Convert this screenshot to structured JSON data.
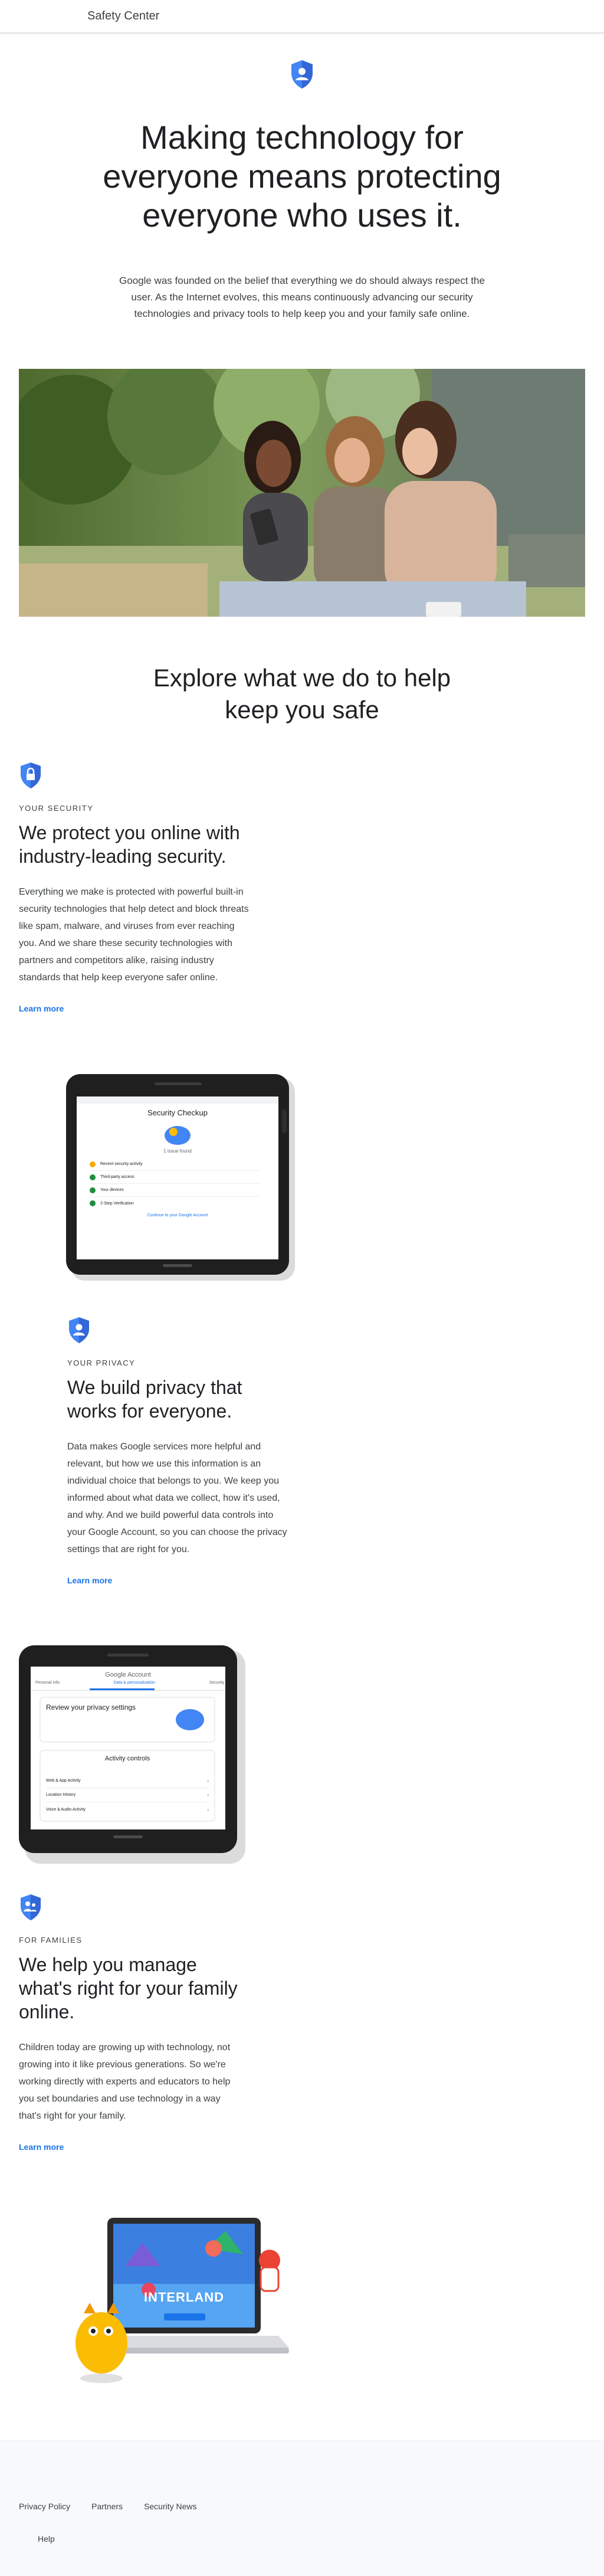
{
  "header": {
    "title": "Safety Center"
  },
  "hero": {
    "headline": "Making technology for everyone means protecting everyone who uses it.",
    "intro": "Google was founded on the belief that everything we do should always respect the user. As the Internet evolves, this means continuously advancing our security technologies and privacy tools to help keep you and your family safe online."
  },
  "explore": {
    "title": "Explore what we do to help keep you safe"
  },
  "sections": [
    {
      "eyebrow": "YOUR SECURITY",
      "title": "We protect you online with industry-leading security.",
      "body": "Everything we make is protected with powerful built-in security technologies that help detect and block threats like spam, malware, and viruses from ever reaching you. And we share these security technologies with partners and competitors alike, raising industry standards that help keep everyone safer online.",
      "link": "Learn more",
      "icon": "lock-shield-icon"
    },
    {
      "eyebrow": "YOUR PRIVACY",
      "title": "We build privacy that works for everyone.",
      "body": "Data makes Google services more helpful and relevant, but how we use this information is an individual choice that belongs to you. We keep you informed about what data we collect, how it's used, and why. And we build powerful data controls into your Google Account, so you can choose the privacy settings that are right for you.",
      "link": "Learn more",
      "icon": "person-shield-icon"
    },
    {
      "eyebrow": "FOR FAMILIES",
      "title": "We help you manage what's right for your family online.",
      "body": "Children today are growing up with technology, not growing into it like previous generations. So we're working directly with experts and educators to help you set boundaries and use technology in a way that's right for your family.",
      "link": "Learn more",
      "icon": "family-shield-icon"
    }
  ],
  "phone1": {
    "title": "Security Checkup",
    "subtitle": "1 issue found",
    "items": [
      {
        "label": "Recent security activity",
        "color": "#f9ab00"
      },
      {
        "label": "Third-party access",
        "color": "#1e8e3e"
      },
      {
        "label": "Your devices",
        "color": "#1e8e3e"
      },
      {
        "label": "2-Step Verification",
        "color": "#1e8e3e"
      }
    ],
    "link": "Continue to your Google Account"
  },
  "phone2": {
    "header": "Google Account",
    "tabs": [
      "Personal info",
      "Data & personalization",
      "Security"
    ],
    "card_title": "Review your privacy settings",
    "section": "Activity controls",
    "rows": [
      "Web & App Activity",
      "Location History",
      "Voice & Audio Activity"
    ]
  },
  "laptop": {
    "banner": "INTERLAND"
  },
  "footer": {
    "links": [
      "Privacy Policy",
      "Partners",
      "Security News"
    ],
    "help": "Help"
  },
  "colors": {
    "accent": "#1a73e8",
    "shield": "#4285f4"
  }
}
